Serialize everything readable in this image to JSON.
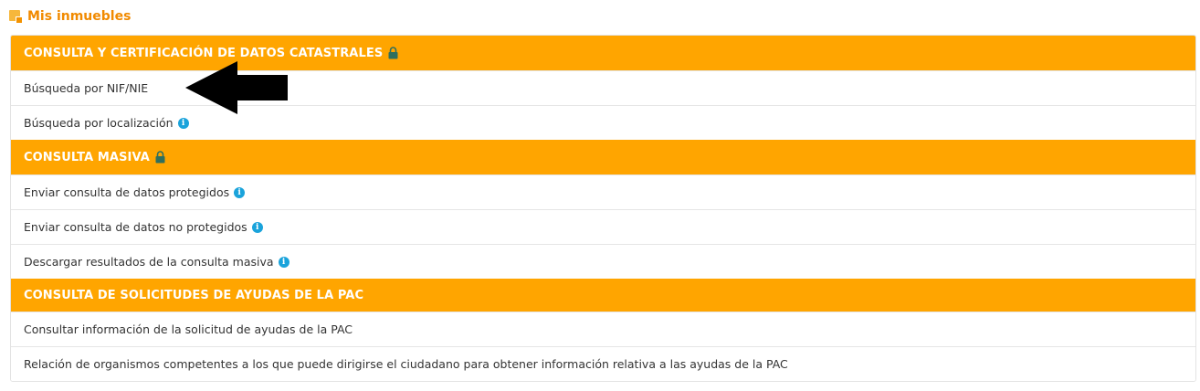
{
  "page": {
    "title": "Mis inmuebles"
  },
  "sections": [
    {
      "title": "CONSULTA Y CERTIFICACIÓN DE DATOS CATASTRALES",
      "items": [
        {
          "label": "Búsqueda por NIF/NIE"
        },
        {
          "label": "Búsqueda por localización"
        }
      ]
    },
    {
      "title": "CONSULTA MASIVA",
      "items": [
        {
          "label": "Enviar consulta de datos protegidos"
        },
        {
          "label": "Enviar consulta de datos no protegidos"
        },
        {
          "label": "Descargar resultados de la consulta masiva"
        }
      ]
    },
    {
      "title": "CONSULTA DE SOLICITUDES DE AYUDAS DE LA PAC",
      "items": [
        {
          "label": "Consultar información de la solicitud de ayudas de la PAC"
        },
        {
          "label": "Relación de organismos competentes a los que puede dirigirse el ciudadano para obtener información relativa a las ayudas de la PAC"
        }
      ]
    }
  ],
  "info_glyph": "i",
  "colors": {
    "header_bg": "#ffa500",
    "title": "#f18a00",
    "info": "#1aa3db",
    "lock": "#2f6f5e"
  }
}
